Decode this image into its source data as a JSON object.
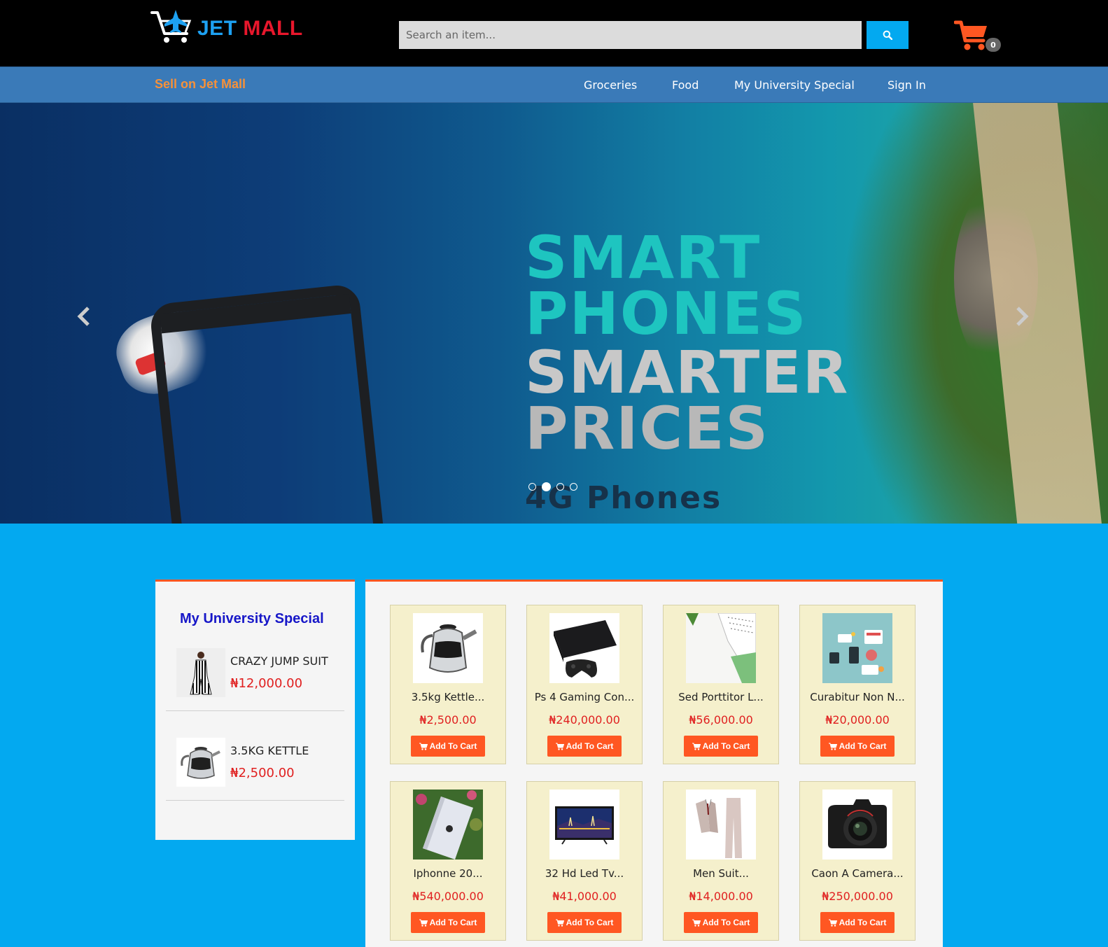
{
  "header": {
    "logo": {
      "jet": "JET",
      "mall": "MALL"
    },
    "search": {
      "placeholder": "Search an item...",
      "button_icon": "search-icon"
    },
    "cart": {
      "icon": "shopping-cart-icon",
      "count": "0",
      "icon_color": "#ff5722"
    }
  },
  "nav": {
    "sell_label": "Sell on Jet Mall",
    "items": [
      {
        "label": "Groceries"
      },
      {
        "label": "Food"
      },
      {
        "label": "My University Special"
      },
      {
        "label": "Sign In"
      }
    ]
  },
  "hero": {
    "line1": "SMART",
    "line2": "PHONES",
    "line3": "SMARTER",
    "line4": "PRICES",
    "line5": "4G Phones",
    "slides_total": 4,
    "active_slide": 2
  },
  "sidebar": {
    "title": "My University Special",
    "items": [
      {
        "name": "CRAZY JUMP SUIT",
        "price": "₦12,000.00",
        "image": "jumpsuit"
      },
      {
        "name": "3.5KG KETTLE",
        "price": "₦2,500.00",
        "image": "kettle"
      }
    ]
  },
  "products": {
    "add_label": "Add To Cart",
    "items": [
      {
        "name": "3.5kg Kettle...",
        "price": "₦2,500.00",
        "image": "kettle"
      },
      {
        "name": "Ps 4 Gaming Con...",
        "price": "₦240,000.00",
        "image": "console"
      },
      {
        "name": "Sed Porttitor L...",
        "price": "₦56,000.00",
        "image": "notebook"
      },
      {
        "name": "Curabitur Non N...",
        "price": "₦20,000.00",
        "image": "tech-icons"
      },
      {
        "name": "Iphonne 20...",
        "price": "₦540,000.00",
        "image": "phone"
      },
      {
        "name": "32 Hd Led Tv...",
        "price": "₦41,000.00",
        "image": "tv"
      },
      {
        "name": "Men Suit...",
        "price": "₦14,000.00",
        "image": "suit"
      },
      {
        "name": "Caon A Camera...",
        "price": "₦250,000.00",
        "image": "camera"
      }
    ]
  },
  "colors": {
    "header_bg": "#000000",
    "nav_bg": "#3a7ab8",
    "accent": "#03a9f0",
    "sell_link": "#f5913a",
    "button": "#ff5722",
    "price": "#e02020",
    "card_bg": "#f5f0cc"
  }
}
